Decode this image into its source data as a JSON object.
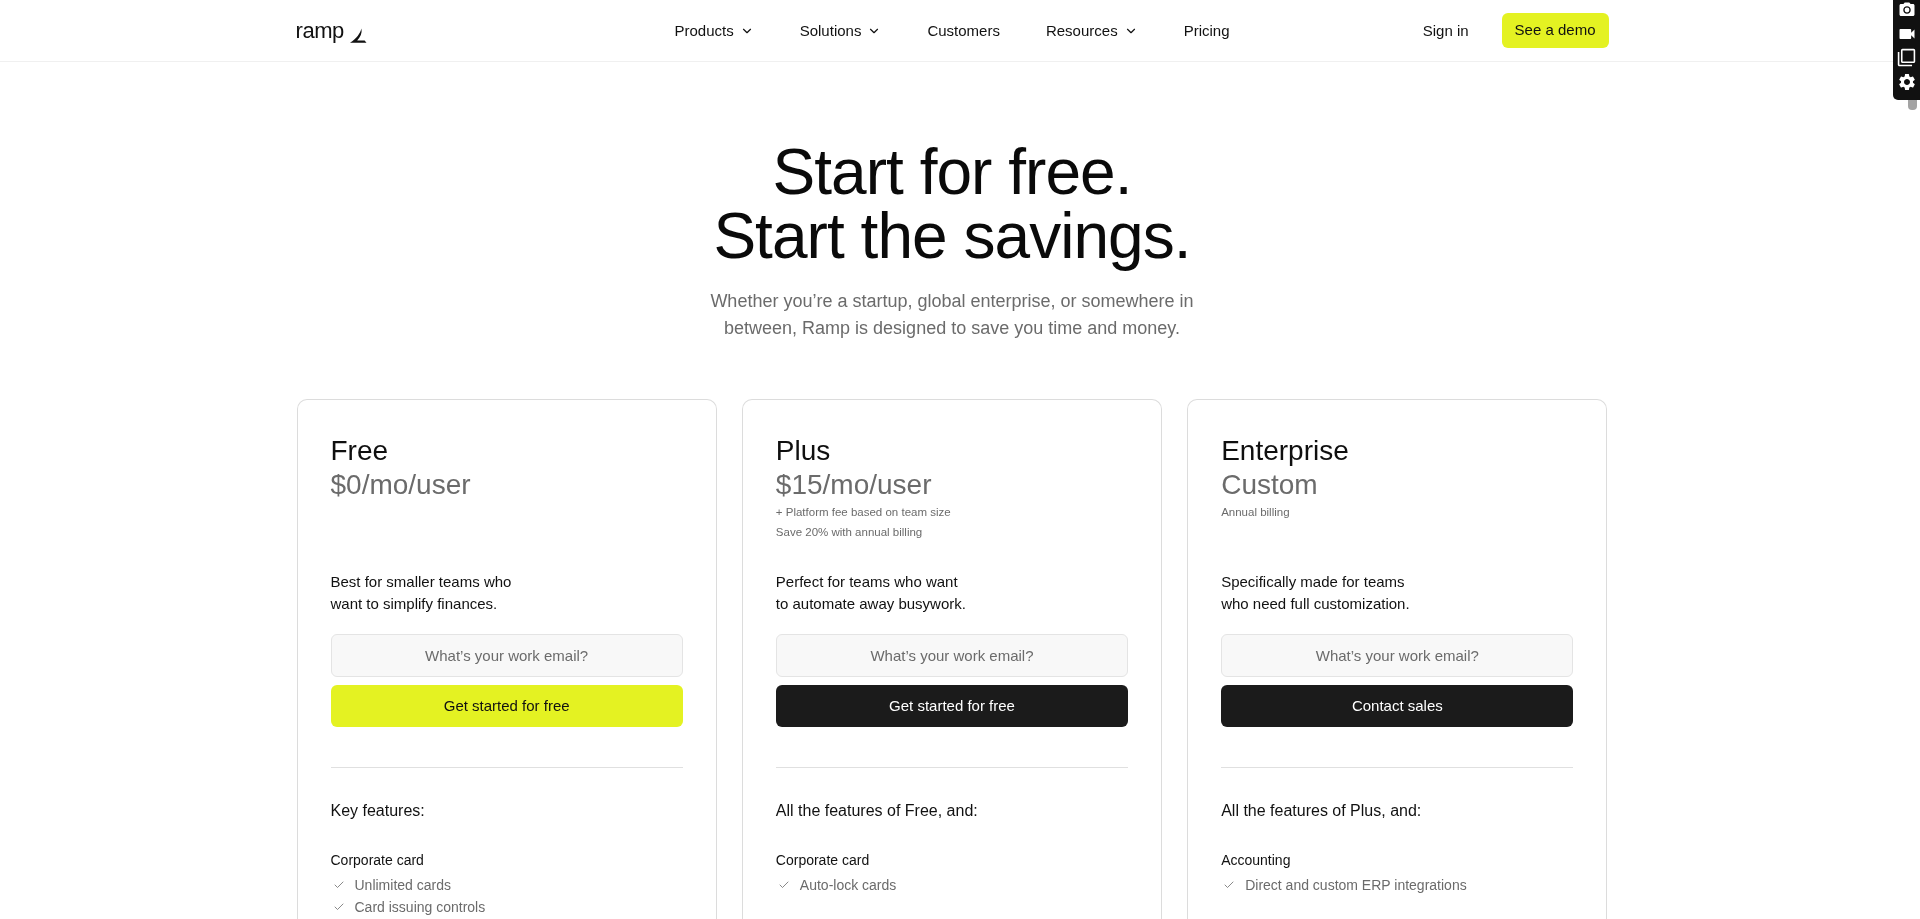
{
  "header": {
    "logo": "ramp",
    "nav": [
      {
        "label": "Products",
        "dropdown": true
      },
      {
        "label": "Solutions",
        "dropdown": true
      },
      {
        "label": "Customers",
        "dropdown": false
      },
      {
        "label": "Resources",
        "dropdown": true
      },
      {
        "label": "Pricing",
        "dropdown": false
      }
    ],
    "sign_in": "Sign in",
    "cta": "See a demo"
  },
  "hero": {
    "title_lines": [
      "Start for free.",
      "Start the savings."
    ],
    "subtitle_lines": [
      "Whether you’re a startup, global enterprise, or somewhere in",
      "between, Ramp is designed to save you time and money."
    ]
  },
  "plans": [
    {
      "name": "Free",
      "price": "$0/mo/user",
      "description_lines": [
        "Best for smaller teams who",
        "want to simplify finances."
      ],
      "email": {
        "placeholder": "What’s your work email?"
      },
      "button": {
        "label": "Get started for free",
        "kind": "accent"
      },
      "features_heading": "Key features:",
      "groups": [
        {
          "title": "Corporate card",
          "items": [
            "Unlimited cards",
            "Card issuing controls"
          ]
        }
      ]
    },
    {
      "name": "Plus",
      "price": "$15/mo/user",
      "notes": [
        "+ Platform fee based on team size",
        "Save 20% with annual billing"
      ],
      "description_lines": [
        "Perfect for teams who want",
        "to automate away busywork."
      ],
      "email": {
        "placeholder": "What’s your work email?"
      },
      "button": {
        "label": "Get started for free",
        "kind": "dark"
      },
      "features_heading": "All the features of Free, and:",
      "groups": [
        {
          "title": "Corporate card",
          "items": [
            "Auto-lock cards"
          ]
        }
      ]
    },
    {
      "name": "Enterprise",
      "price": "Custom",
      "notes": [
        "Annual billing"
      ],
      "description_lines": [
        "Specifically made for teams",
        "who need full customization."
      ],
      "email": {
        "placeholder": "What’s your work email?"
      },
      "button": {
        "label": "Contact sales",
        "kind": "dark"
      },
      "features_heading": "All the features of Plus, and:",
      "groups": [
        {
          "title": "Accounting",
          "items": [
            "Direct and custom ERP integrations"
          ]
        }
      ]
    }
  ]
}
